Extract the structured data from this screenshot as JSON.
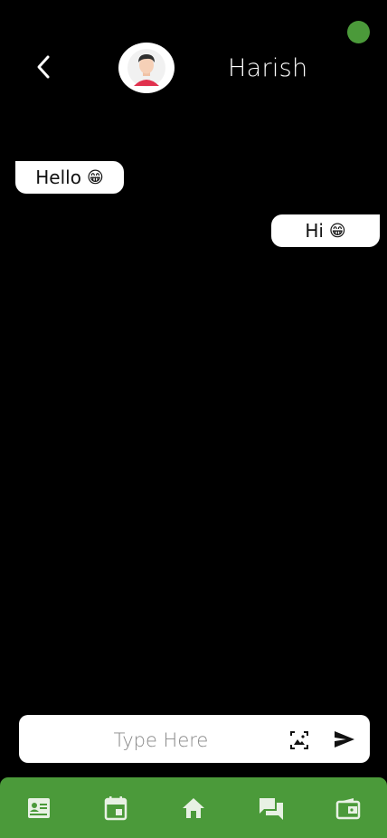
{
  "header": {
    "contact_name": "Harish",
    "online_color": "#4b9a3a",
    "back_icon": "chevron-left-icon",
    "avatar_icon": "user-avatar-icon"
  },
  "messages": [
    {
      "direction": "incoming",
      "text": "Hello",
      "emoji": "😁"
    },
    {
      "direction": "outgoing",
      "text": "Hi",
      "emoji": "😁"
    }
  ],
  "composer": {
    "placeholder": "Type Here",
    "value": "",
    "image_icon": "image-picker-icon",
    "send_icon": "send-icon"
  },
  "bottom_nav": {
    "background": "#4b9a3a",
    "items": [
      {
        "icon": "profile-card-icon"
      },
      {
        "icon": "calendar-icon"
      },
      {
        "icon": "home-icon"
      },
      {
        "icon": "chat-icon"
      },
      {
        "icon": "wallet-icon"
      }
    ]
  }
}
